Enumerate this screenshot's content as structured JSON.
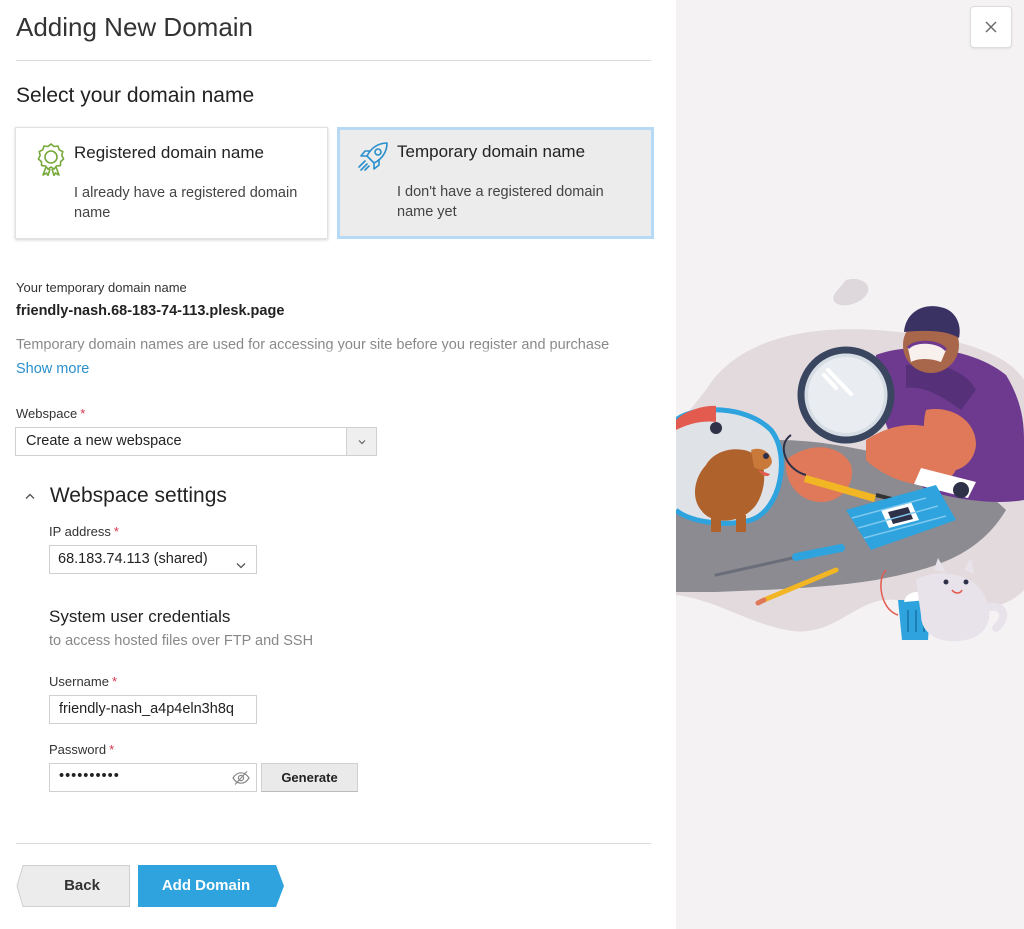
{
  "dialog": {
    "title": "Adding New Domain"
  },
  "domain_select": {
    "heading": "Select your domain name",
    "options": [
      {
        "title": "Registered domain name",
        "description": "I already have a registered domain name",
        "icon": "certificate-icon",
        "selected": false
      },
      {
        "title": "Temporary domain name",
        "description": "I don't have a registered domain name yet",
        "icon": "rocket-icon",
        "selected": true
      }
    ]
  },
  "temporary": {
    "label": "Your temporary domain name",
    "value": "friendly-nash.68-183-74-113.plesk.page",
    "note": "Temporary domain names are used for accessing your site before you register and purchase",
    "show_more": "Show more"
  },
  "webspace": {
    "label": "Webspace",
    "required_mark": "*",
    "value": "Create a new webspace"
  },
  "webspace_settings": {
    "heading": "Webspace settings",
    "ip_label": "IP address",
    "ip_value": "68.183.74.113 (shared)",
    "credentials_title": "System user credentials",
    "credentials_subtitle": "to access hosted files over FTP and SSH",
    "username_label": "Username",
    "username_value": "friendly-nash_a4p4eln3h8q",
    "password_label": "Password",
    "password_value": "••••••••••",
    "generate_label": "Generate"
  },
  "footer": {
    "back_label": "Back",
    "add_label": "Add Domain"
  },
  "colors": {
    "accent": "#2a8fcc",
    "primary_button": "#2ea3de",
    "required": "#d6334c",
    "selected_border": "#b6daf5",
    "certificate_icon": "#77a83a",
    "rocket_icon": "#2a8fcc"
  }
}
